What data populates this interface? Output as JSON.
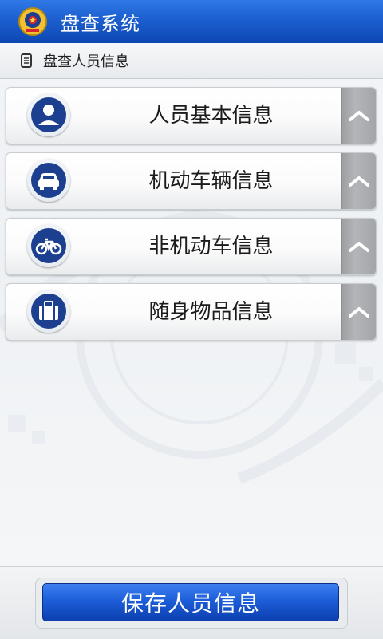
{
  "app": {
    "title": "盘查系统"
  },
  "subheader": {
    "title": "盘查人员信息"
  },
  "sections": [
    {
      "label": "人员基本信息",
      "icon": "person-icon"
    },
    {
      "label": "机动车辆信息",
      "icon": "car-icon"
    },
    {
      "label": "非机动车信息",
      "icon": "bicycle-icon"
    },
    {
      "label": "随身物品信息",
      "icon": "luggage-icon"
    }
  ],
  "footer": {
    "save_label": "保存人员信息"
  },
  "colors": {
    "titlebar": "#1c5fcf",
    "icon_circle": "#1c3f8f",
    "save_button": "#1d5ed8"
  }
}
